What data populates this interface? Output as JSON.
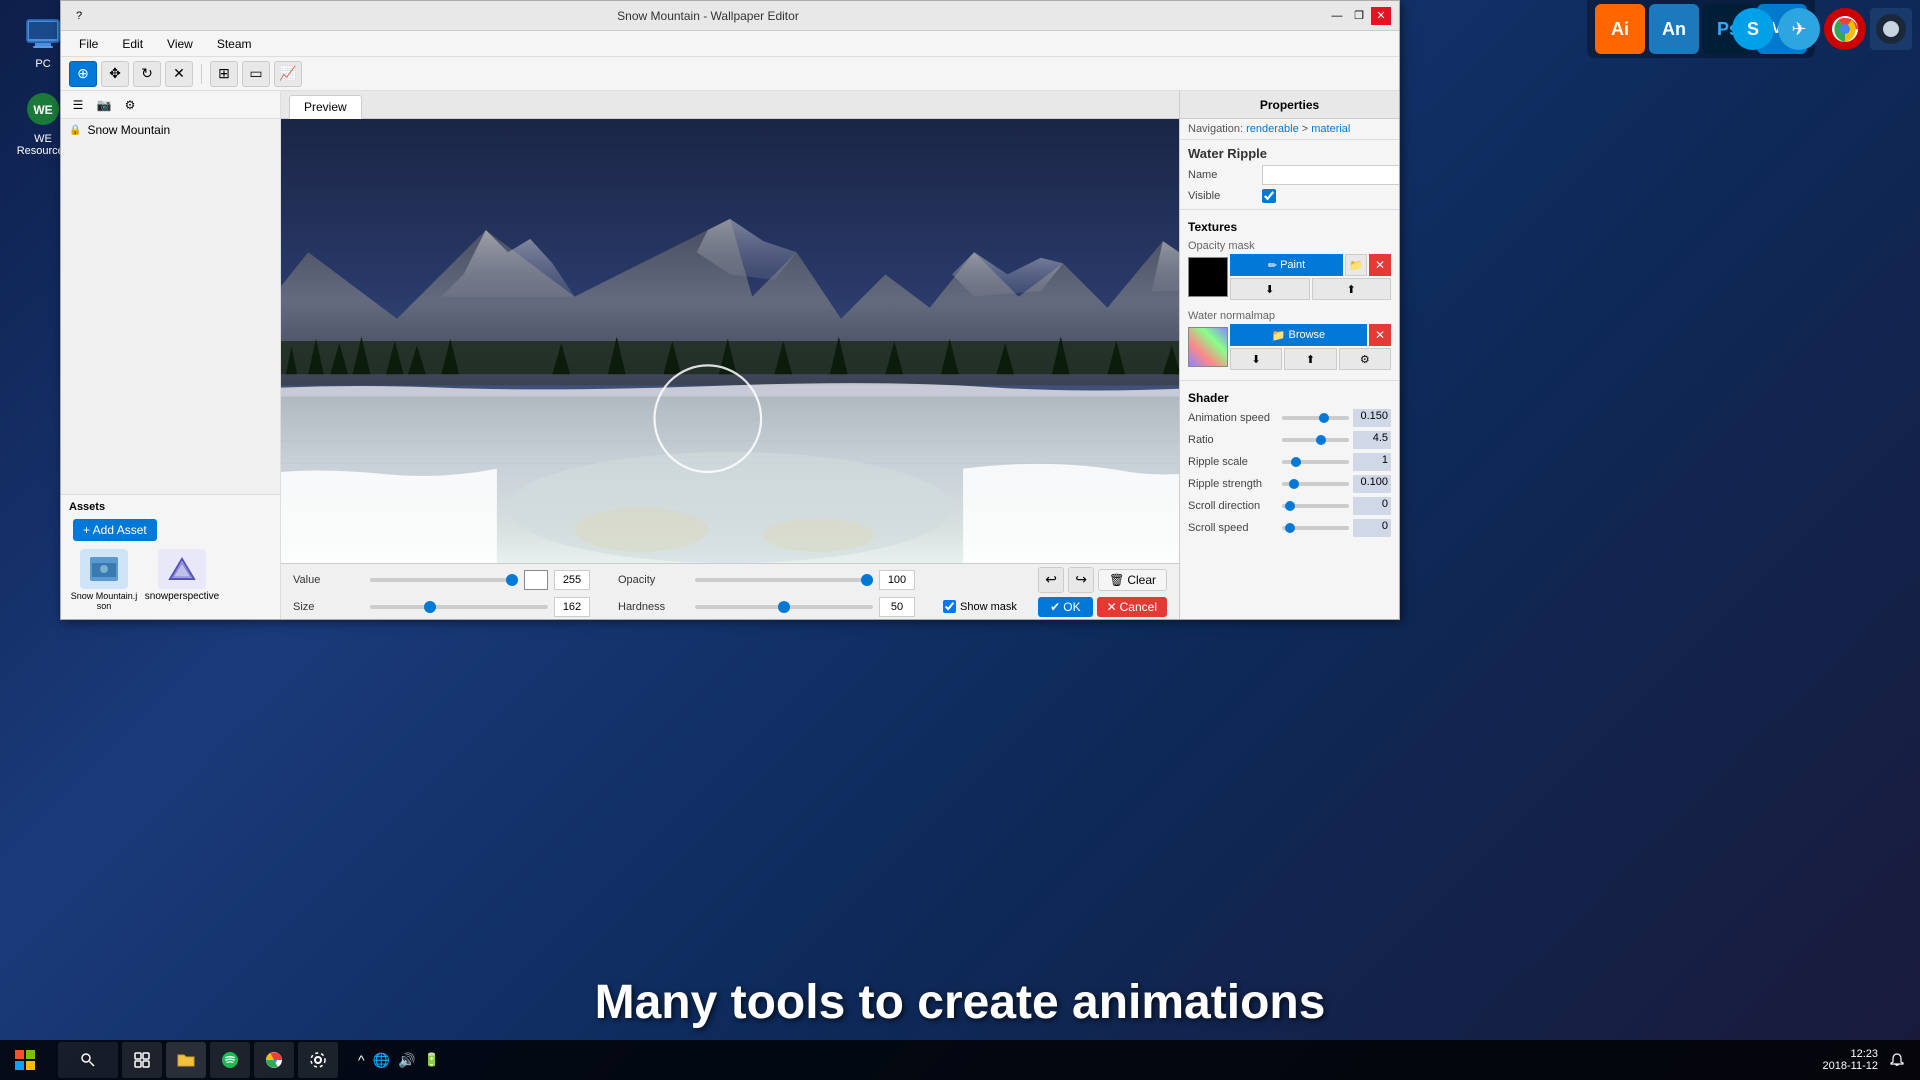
{
  "desktop": {
    "icons": [
      {
        "id": "pc",
        "label": "PC",
        "symbol": "🖥️"
      },
      {
        "id": "we-resources",
        "label": "WE Resources",
        "symbol": "📦"
      }
    ]
  },
  "topright_apps": [
    {
      "id": "illustrator",
      "label": "Ai",
      "bg": "#ff6600",
      "color": "white"
    },
    {
      "id": "animate",
      "label": "An",
      "bg": "#0099cc",
      "color": "white"
    },
    {
      "id": "photoshop",
      "label": "Ps",
      "bg": "#001e36",
      "color": "#31a8ff"
    },
    {
      "id": "vscode",
      "label": "VS",
      "bg": "#007acc",
      "color": "white"
    }
  ],
  "window": {
    "title": "Snow Mountain - Wallpaper Editor",
    "title_help": "?",
    "title_minimize": "—",
    "title_restore": "❐",
    "title_close": "✕"
  },
  "menubar": {
    "items": [
      "File",
      "Edit",
      "View",
      "Steam"
    ]
  },
  "toolbar": {
    "tools": [
      {
        "id": "pan",
        "symbol": "⊕",
        "active": true
      },
      {
        "id": "move",
        "symbol": "✥"
      },
      {
        "id": "refresh",
        "symbol": "↻"
      },
      {
        "id": "close-mask",
        "symbol": "✕"
      },
      {
        "id": "sep1",
        "type": "sep"
      },
      {
        "id": "grid",
        "symbol": "⊞"
      },
      {
        "id": "frame",
        "symbol": "▭"
      },
      {
        "id": "chart",
        "symbol": "📈"
      }
    ]
  },
  "left_panel": {
    "toolbar_items": [
      {
        "id": "list",
        "symbol": "☰"
      },
      {
        "id": "camera",
        "symbol": "📷"
      },
      {
        "id": "settings",
        "symbol": "⚙"
      }
    ],
    "project": {
      "name": "Snow Mountain",
      "lock": true
    }
  },
  "assets": {
    "title": "Assets",
    "add_button": "+ Add Asset",
    "items": [
      {
        "id": "snow-mountain-json",
        "label": "Snow Mountain.json",
        "icon": "🖼️"
      },
      {
        "id": "snowperspective",
        "label": "snowperspective",
        "icon": "⭐"
      }
    ]
  },
  "canvas": {
    "tab": "Preview"
  },
  "bottom_tools": {
    "value_label": "Value",
    "value_num": "255",
    "opacity_label": "Opacity",
    "opacity_num": "100",
    "size_label": "Size",
    "size_num": "162",
    "hardness_label": "Hardness",
    "hardness_num": "50",
    "show_mask_label": "Show mask",
    "undo": "↩",
    "redo": "↪",
    "clear": "Clear",
    "clear_icon": "🗑",
    "ok": "OK",
    "ok_icon": "✔",
    "cancel": "Cancel",
    "cancel_icon": "✕"
  },
  "properties": {
    "header": "Properties",
    "nav": "Navigation: renderable > material",
    "nav_link_start": "renderable",
    "nav_link_end": "material",
    "section_title": "Water Ripple",
    "name_label": "Name",
    "name_value": "",
    "visible_label": "Visible",
    "visible_checked": true,
    "textures_title": "Textures",
    "opacity_mask_label": "Opacity mask",
    "paint_btn": "Paint",
    "browse_btn": "Browse",
    "water_normalmap_label": "Water normalmap",
    "shader_title": "Shader",
    "shader_rows": [
      {
        "id": "animation-speed",
        "label": "Animation speed",
        "value": "0.150",
        "pct": 65
      },
      {
        "id": "ratio",
        "label": "Ratio",
        "value": "4.5",
        "pct": 60
      },
      {
        "id": "ripple-scale",
        "label": "Ripple scale",
        "value": "1",
        "pct": 15
      },
      {
        "id": "ripple-strength",
        "label": "Ripple strength",
        "value": "0.100",
        "pct": 12
      },
      {
        "id": "scroll-direction",
        "label": "Scroll direction",
        "value": "0",
        "pct": 5
      },
      {
        "id": "scroll-speed",
        "label": "Scroll speed",
        "value": "0",
        "pct": 5
      }
    ]
  },
  "subtitle": {
    "text": "Many tools to create animations"
  },
  "taskbar": {
    "time": "12:23",
    "date": "2018-11-12",
    "start_label": "⊞"
  }
}
